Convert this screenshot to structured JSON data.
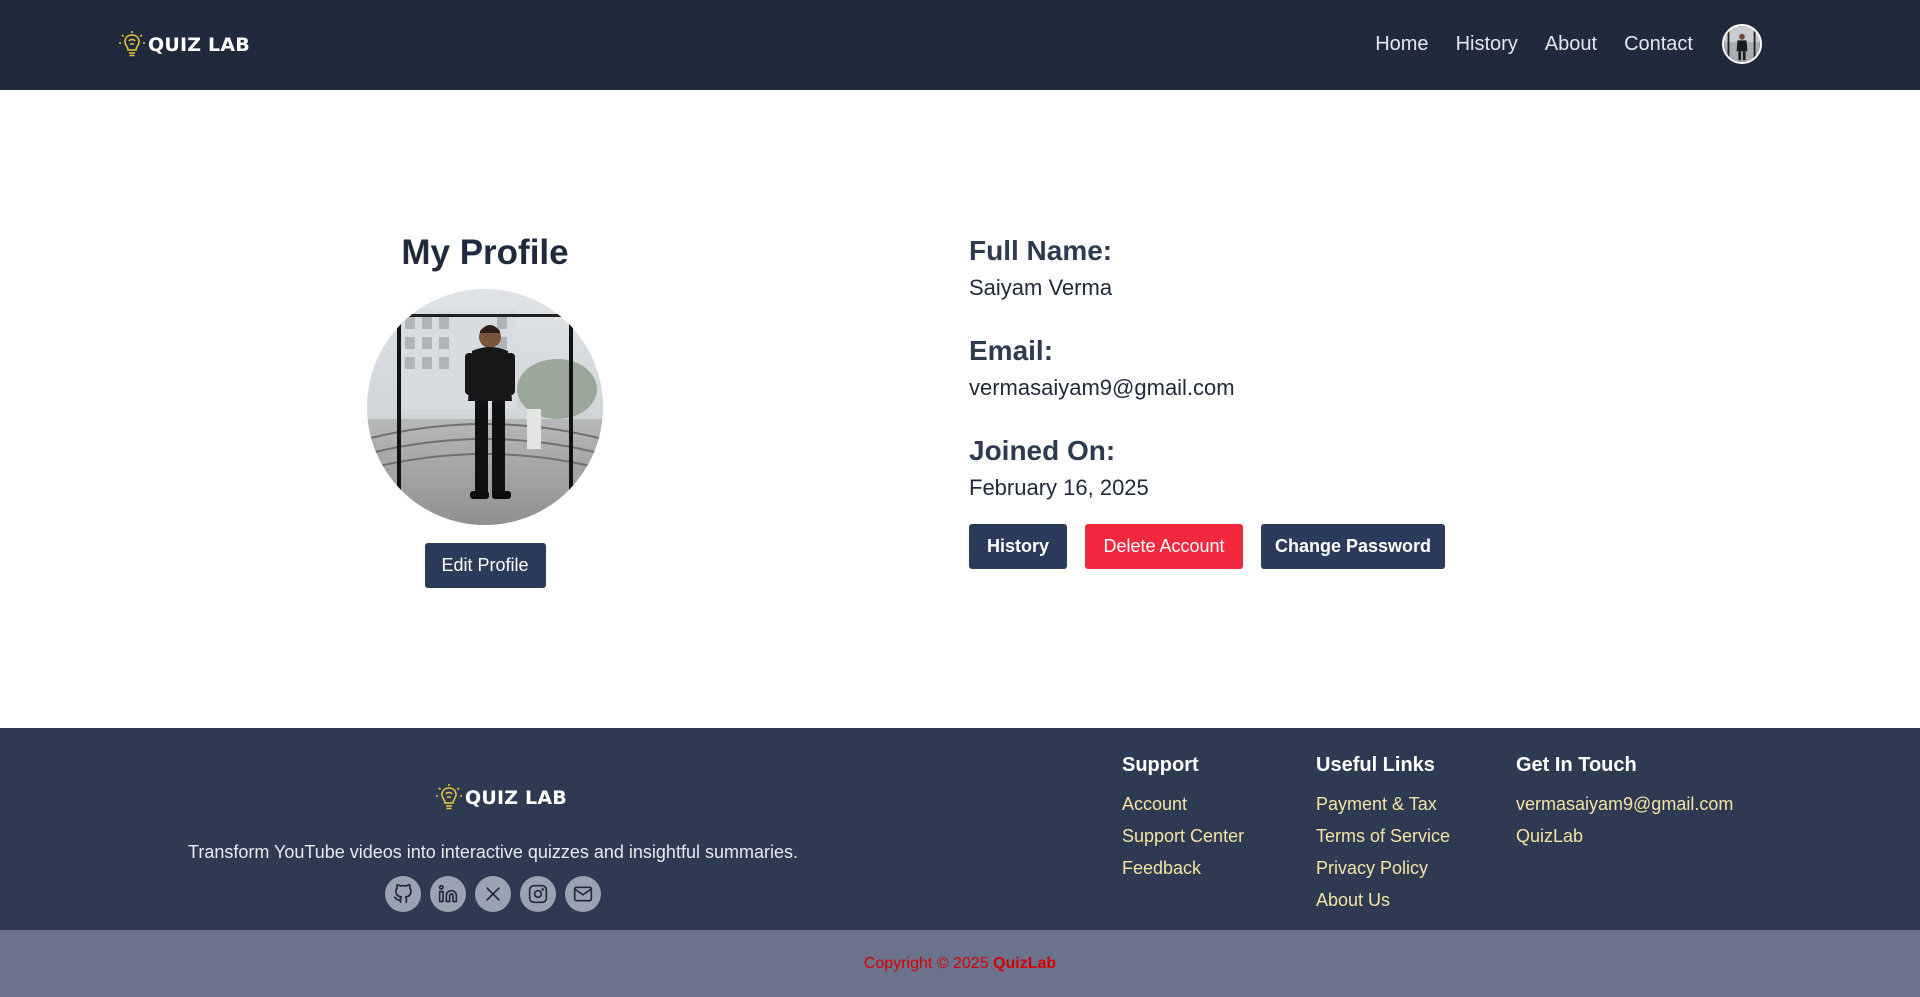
{
  "navbar": {
    "brand": "QUIZ LAB",
    "links": [
      "Home",
      "History",
      "About",
      "Contact"
    ]
  },
  "profile": {
    "title": "My Profile",
    "edit_label": "Edit Profile",
    "fields": [
      {
        "label": "Full Name:",
        "value": "Saiyam Verma"
      },
      {
        "label": "Email:",
        "value": "vermasaiyam9@gmail.com"
      },
      {
        "label": "Joined On:",
        "value": "February 16, 2025"
      }
    ],
    "actions": {
      "history": "History",
      "delete": "Delete Account",
      "change_password": "Change Password"
    }
  },
  "footer": {
    "brand": "QUIZ LAB",
    "tagline": "Transform YouTube videos into interactive quizzes and insightful summaries.",
    "socials": [
      "github-icon",
      "linkedin-icon",
      "x-icon",
      "instagram-icon",
      "mail-icon"
    ],
    "support": {
      "title": "Support",
      "links": [
        "Account",
        "Support Center",
        "Feedback"
      ]
    },
    "useful_links": {
      "title": "Useful Links",
      "links": [
        "Payment & Tax",
        "Terms of Service",
        "Privacy Policy",
        "About Us"
      ]
    },
    "get_in_touch": {
      "title": "Get In Touch",
      "links": [
        "vermasaiyam9@gmail.com",
        "QuizLab"
      ]
    },
    "copyright_prefix": "Copyright © 2025",
    "copyright_brand": "QuizLab"
  },
  "colors": {
    "navbar_bg": "#1f2a3c",
    "footer_bg": "#2d3a51",
    "copyright_bg": "#6b738c",
    "primary_button": "#2c3a5c",
    "danger_button": "#f2293e",
    "footer_link": "#f3e3a4",
    "brand_accent": "#e8c23a"
  }
}
